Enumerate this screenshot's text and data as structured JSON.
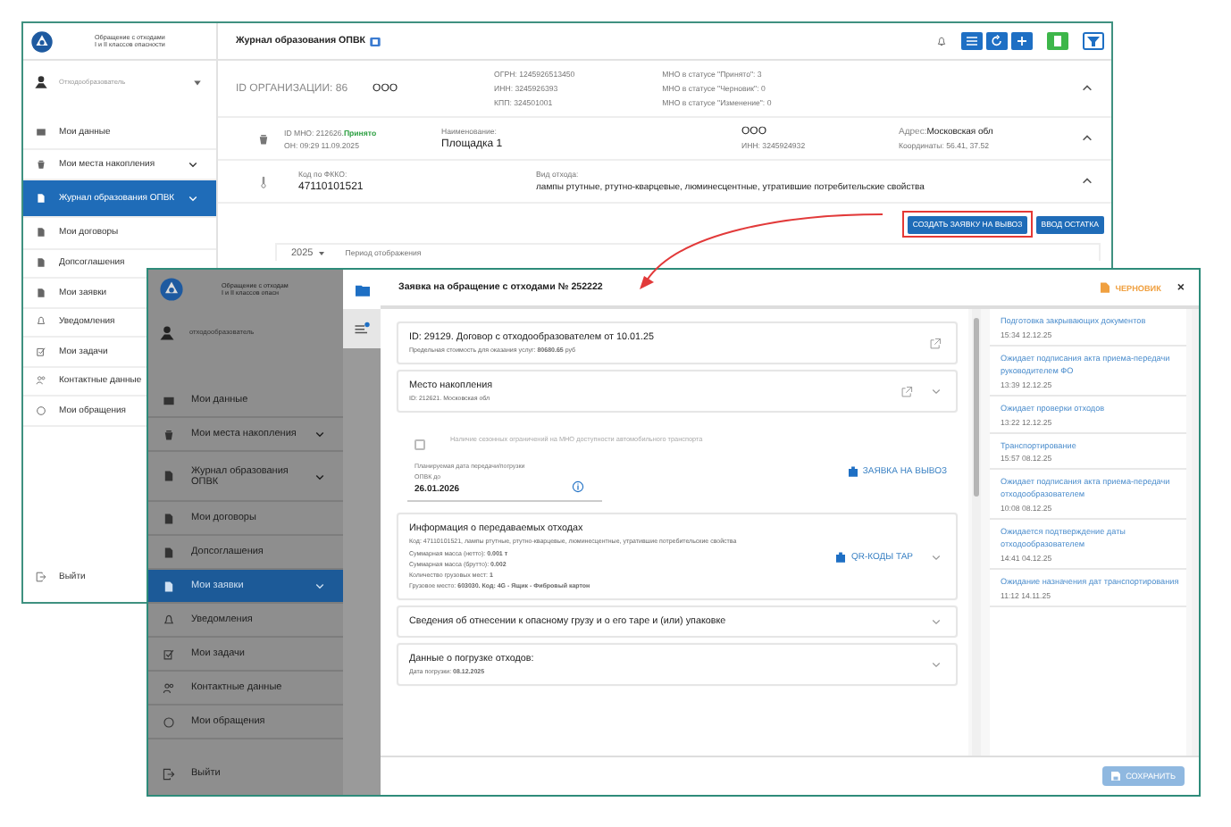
{
  "back_window": {
    "header_text": [
      "Обращение с отходами",
      "I и II классов опасности"
    ],
    "role": "Отходообразователь",
    "nav": [
      {
        "label": "Мои данные",
        "expandable": false,
        "selected": false
      },
      {
        "label": "Мои места накопления",
        "expandable": true,
        "selected": false
      },
      {
        "label": "Журнал образования ОПВК",
        "expandable": true,
        "selected": true
      },
      {
        "label": "Мои договоры",
        "expandable": false,
        "selected": false
      },
      {
        "label": "Допсоглашения",
        "expandable": false,
        "selected": false
      },
      {
        "label": "Мои заявки",
        "expandable": false,
        "selected": false
      },
      {
        "label": "Уведомления",
        "expandable": false,
        "selected": false
      },
      {
        "label": "Мои задачи",
        "expandable": false,
        "selected": false
      },
      {
        "label": "Контактные данные",
        "expandable": false,
        "selected": false
      },
      {
        "label": "Мои обращения",
        "expandable": false,
        "selected": false
      }
    ],
    "logout": "Выйти",
    "title": "Журнал образования ОПВК",
    "org": {
      "id": "ID ОРГАНИЗАЦИИ: 86",
      "name": "ООО",
      "codes": [
        "ОГРН: 1245926513450",
        "ИНН: 3245926393",
        "КПП: 324501001"
      ],
      "counts": [
        "МНО в статусе \"Принято\": 3",
        "МНО в статусе \"Черновик\": 0",
        "МНО в статусе \"Изменение\": 0"
      ]
    },
    "mno": {
      "id": "ID МНО: 212626.",
      "status": "Принято",
      "date": "ОН: 09:29 11.09.2025",
      "name_label": "Наименование:",
      "name": "Площадка 1",
      "owner": "ООО",
      "owner_inn": "ИНН: 3245924932",
      "address_label": "Адрес:",
      "address": "Московская обл",
      "coords": "Координаты: 56.41, 37.52"
    },
    "waste": {
      "code_label": "Код по ФККО:",
      "code": "47110101521",
      "type_label": "Вид отхода:",
      "type": "лампы ртутные, ртутно-кварцевые, люминесцентные, утратившие потребительские свойства"
    },
    "buttons": [
      {
        "label": "СОЗДАТЬ ЗАЯВКУ НА ВЫВОЗ",
        "highlighted": true
      },
      {
        "label": "ВВОД ОСТАТКА",
        "highlighted": false
      }
    ],
    "year": "2025",
    "period_label": "Период отображения"
  },
  "front_window": {
    "header_text": [
      "Обращение с отходам",
      "I и II классов опасн"
    ],
    "role": "отходообразователь",
    "nav": [
      {
        "label": "Мои данные",
        "expandable": false,
        "selected": false
      },
      {
        "label": "Мои места накопления",
        "expandable": true,
        "selected": false
      },
      {
        "label": "Журнал образования ОПВК",
        "expandable": true,
        "selected": false
      },
      {
        "label": "Мои договоры",
        "expandable": false,
        "selected": false
      },
      {
        "label": "Допсоглашения",
        "expandable": false,
        "selected": false
      },
      {
        "label": "Мои заявки",
        "expandable": true,
        "selected": true
      },
      {
        "label": "Уведомления",
        "expandable": false,
        "selected": false
      },
      {
        "label": "Мои задачи",
        "expandable": false,
        "selected": false
      },
      {
        "label": "Контактные данные",
        "expandable": false,
        "selected": false
      },
      {
        "label": "Мои обращения",
        "expandable": false,
        "selected": false
      }
    ],
    "logout": "Выйти",
    "dialog": {
      "title": "Заявка на обращение с отходами № 252222",
      "status": "ЧЕРНОВИК",
      "close": "×",
      "contract": {
        "title": "ID: 29129. Договор с отходообразователем от 10.01.25",
        "note": "Предельная стоимость для оказания услуг: **80680.65** руб"
      },
      "site": {
        "title": "Место накопления",
        "note": "ID: 212621. Московская обл"
      },
      "seasonal": {
        "label": "Наличие сезонных ограничений на МНО доступности автомобильного транспорта",
        "checked": false,
        "disabled": true
      },
      "date_field": {
        "label": "Планируемая дата передачи/погрузки ОПВК до",
        "value": "26.01.2026"
      },
      "pickup_link": "ЗАЯВКА НА ВЫВОЗ",
      "waste_info": {
        "title": "Информация о передаваемых отходах",
        "lines": [
          "Код: 47110101521, лампы ртутные, ртутно-кварцевые, люминесцентные, утратившие потребительские свойства",
          "Суммарная масса (нетто): **0.001 т**",
          "Суммарная масса (брутто): **0.002**",
          "Количество грузовых мест: **1**",
          "Грузовое место: **603030. Код: 4G - Ящик - Фибровый картон**"
        ],
        "qr_link": "QR-КОДЫ ТАР"
      },
      "hazard": "Сведения об отнесении к опасному грузу и о его таре и (или) упаковке",
      "loading": {
        "title": "Данные о погрузке отходов:",
        "note": "Дата погрузки: **08.12.2025**"
      },
      "save": {
        "label": "СОХРАНИТЬ",
        "disabled": true
      },
      "history": [
        {
          "text": "Подготовка закрывающих документов",
          "time": "15:34 12.12.25"
        },
        {
          "text": "Ожидает подписания акта приема-передачи руководителем ФО",
          "time": "13:39 12.12.25"
        },
        {
          "text": "Ожидает проверки отходов",
          "time": "13:22 12.12.25"
        },
        {
          "text": "Транспортирование",
          "time": "15:57 08.12.25"
        },
        {
          "text": "Ожидает подписания акта приема-передачи отходообразователем",
          "time": "10:08 08.12.25"
        },
        {
          "text": "Ожидается подтверждение даты отходообразователем",
          "time": "14:41 04.12.25"
        },
        {
          "text": "Ожидание назначения дат транспортирования",
          "time": "11:12 14.11.25"
        }
      ]
    }
  }
}
